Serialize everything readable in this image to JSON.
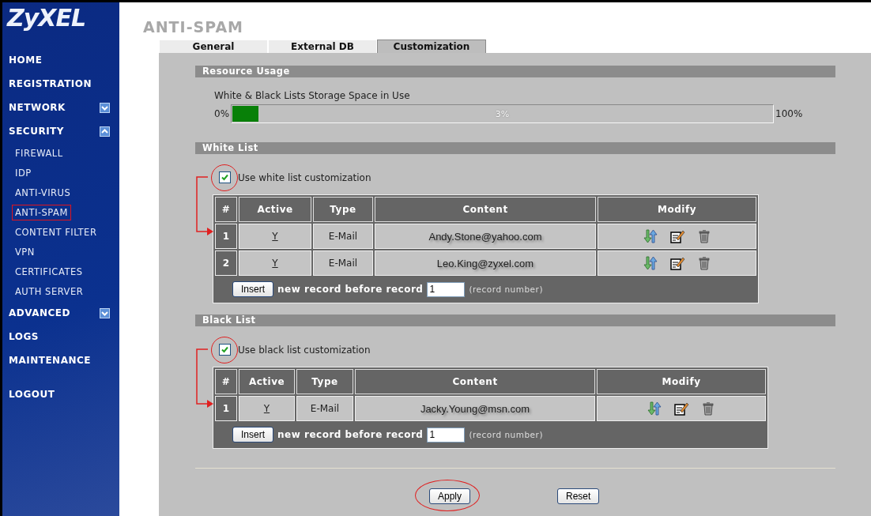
{
  "logo": "ZyXEL",
  "sidebar": {
    "items": [
      {
        "label": "HOME",
        "kind": "main",
        "selected": false
      },
      {
        "label": "REGISTRATION",
        "kind": "main",
        "selected": false
      },
      {
        "label": "NETWORK",
        "kind": "main",
        "selected": false,
        "expanded": false
      },
      {
        "label": "SECURITY",
        "kind": "main",
        "selected": false,
        "expanded": true,
        "children": [
          {
            "label": "FIREWALL",
            "kind": "sub",
            "selected": false
          },
          {
            "label": "IDP",
            "kind": "sub",
            "selected": false
          },
          {
            "label": "ANTI-VIRUS",
            "kind": "sub",
            "selected": false
          },
          {
            "label": "ANTI-SPAM",
            "kind": "sub",
            "selected": true
          },
          {
            "label": "CONTENT FILTER",
            "kind": "sub",
            "selected": false
          },
          {
            "label": "VPN",
            "kind": "sub",
            "selected": false
          },
          {
            "label": "CERTIFICATES",
            "kind": "sub",
            "selected": false
          },
          {
            "label": "AUTH SERVER",
            "kind": "sub",
            "selected": false
          }
        ]
      },
      {
        "label": "ADVANCED",
        "kind": "main",
        "selected": false,
        "expanded": false
      },
      {
        "label": "LOGS",
        "kind": "main",
        "selected": false
      },
      {
        "label": "MAINTENANCE",
        "kind": "main",
        "selected": false
      },
      {
        "label": "LOGOUT",
        "kind": "logout",
        "selected": false
      }
    ]
  },
  "page_title": "ANTI-SPAM",
  "tabs": [
    {
      "label": "General",
      "selected": false
    },
    {
      "label": "External DB",
      "selected": false
    },
    {
      "label": "Customization",
      "selected": true
    }
  ],
  "resource_usage": {
    "title": "Resource Usage",
    "caption": "White & Black Lists Storage Space in Use",
    "min_label": "0%",
    "max_label": "100%",
    "reading": "3%",
    "level": 0.03
  },
  "lists": [
    {
      "title": "White List",
      "option": {
        "label": "Use white list customization",
        "checked": true,
        "annotated": true
      },
      "columns": [
        "#",
        "Active",
        "Type",
        "Content",
        "Modify"
      ],
      "rows": [
        {
          "index": "1",
          "active": "Y",
          "type": "E-Mail",
          "content": "Andy.Stone@yahoo.com"
        },
        {
          "index": "2",
          "active": "Y",
          "type": "E-Mail",
          "content": "Leo.King@zyxel.com"
        }
      ],
      "insert": {
        "button": "Insert",
        "label": "new record before record",
        "value": "1",
        "hint": "(record number)"
      }
    },
    {
      "title": "Black List",
      "option": {
        "label": "Use black list customization",
        "checked": true,
        "annotated": true
      },
      "columns": [
        "#",
        "Active",
        "Type",
        "Content",
        "Modify"
      ],
      "rows": [
        {
          "index": "1",
          "active": "Y",
          "type": "E-Mail",
          "content": "Jacky.Young@msn.com"
        }
      ],
      "insert": {
        "button": "Insert",
        "label": "new record before record",
        "value": "1",
        "hint": "(record number)"
      }
    }
  ],
  "buttons": [
    {
      "label": "Apply",
      "annotated": true
    },
    {
      "label": "Reset",
      "annotated": false
    }
  ]
}
